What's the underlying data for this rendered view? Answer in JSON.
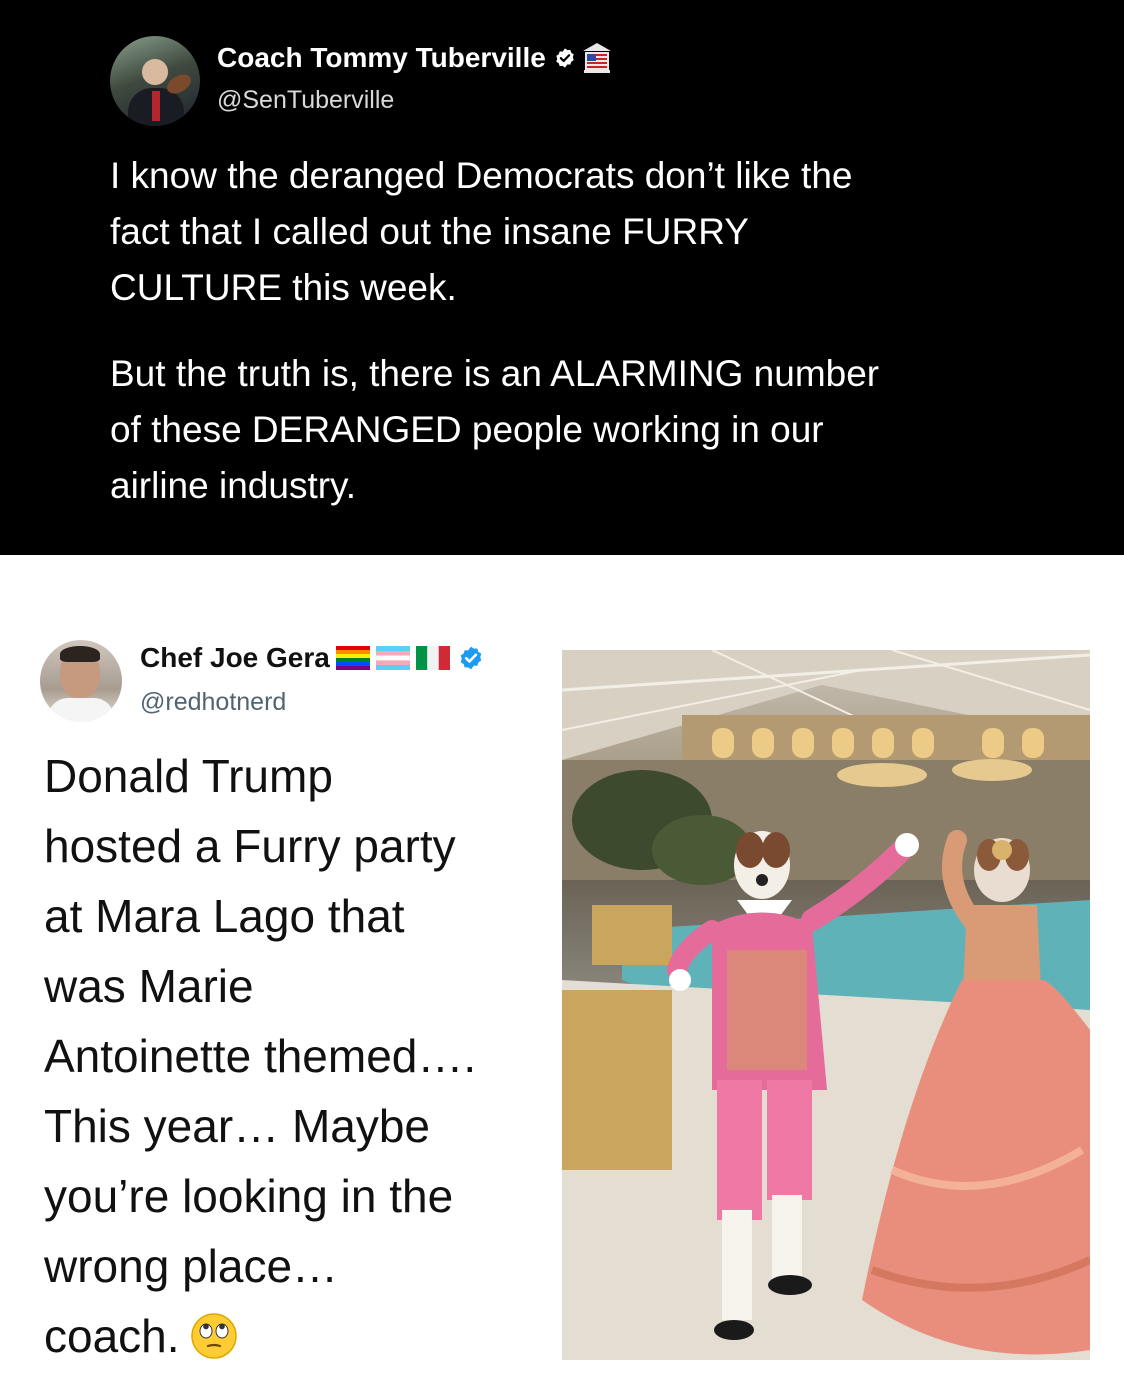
{
  "top_tweet": {
    "display_name": "Coach Tommy Tuberville",
    "handle": "@SenTuberville",
    "paragraph_1_lines": [
      "I know the deranged Democrats don’t like the",
      "fact that I called out the insane FURRY",
      "CULTURE this week."
    ],
    "paragraph_2_lines": [
      "But the truth is, there is an ALARMING number",
      "of these DERANGED people working in our",
      "airline industry."
    ],
    "icons": [
      "verified-badge-icon",
      "senate-building-icon"
    ]
  },
  "bottom_tweet": {
    "display_name": "Chef Joe Gera",
    "handle": "@redhotnerd",
    "body_lines": [
      "Donald Trump",
      "hosted a Furry party",
      "at Mara Lago that",
      "was Marie",
      "Antoinette themed….",
      "This year… Maybe",
      "you’re looking in the",
      "wrong place…",
      "coach."
    ],
    "icons": [
      "rainbow-flag-icon",
      "transgender-flag-icon",
      "italian-flag-icon",
      "verified-badge-icon",
      "eye-roll-emoji-icon"
    ],
    "colors": {
      "verified_blue": "#1d9bf0",
      "handle_gray": "#536471"
    }
  }
}
